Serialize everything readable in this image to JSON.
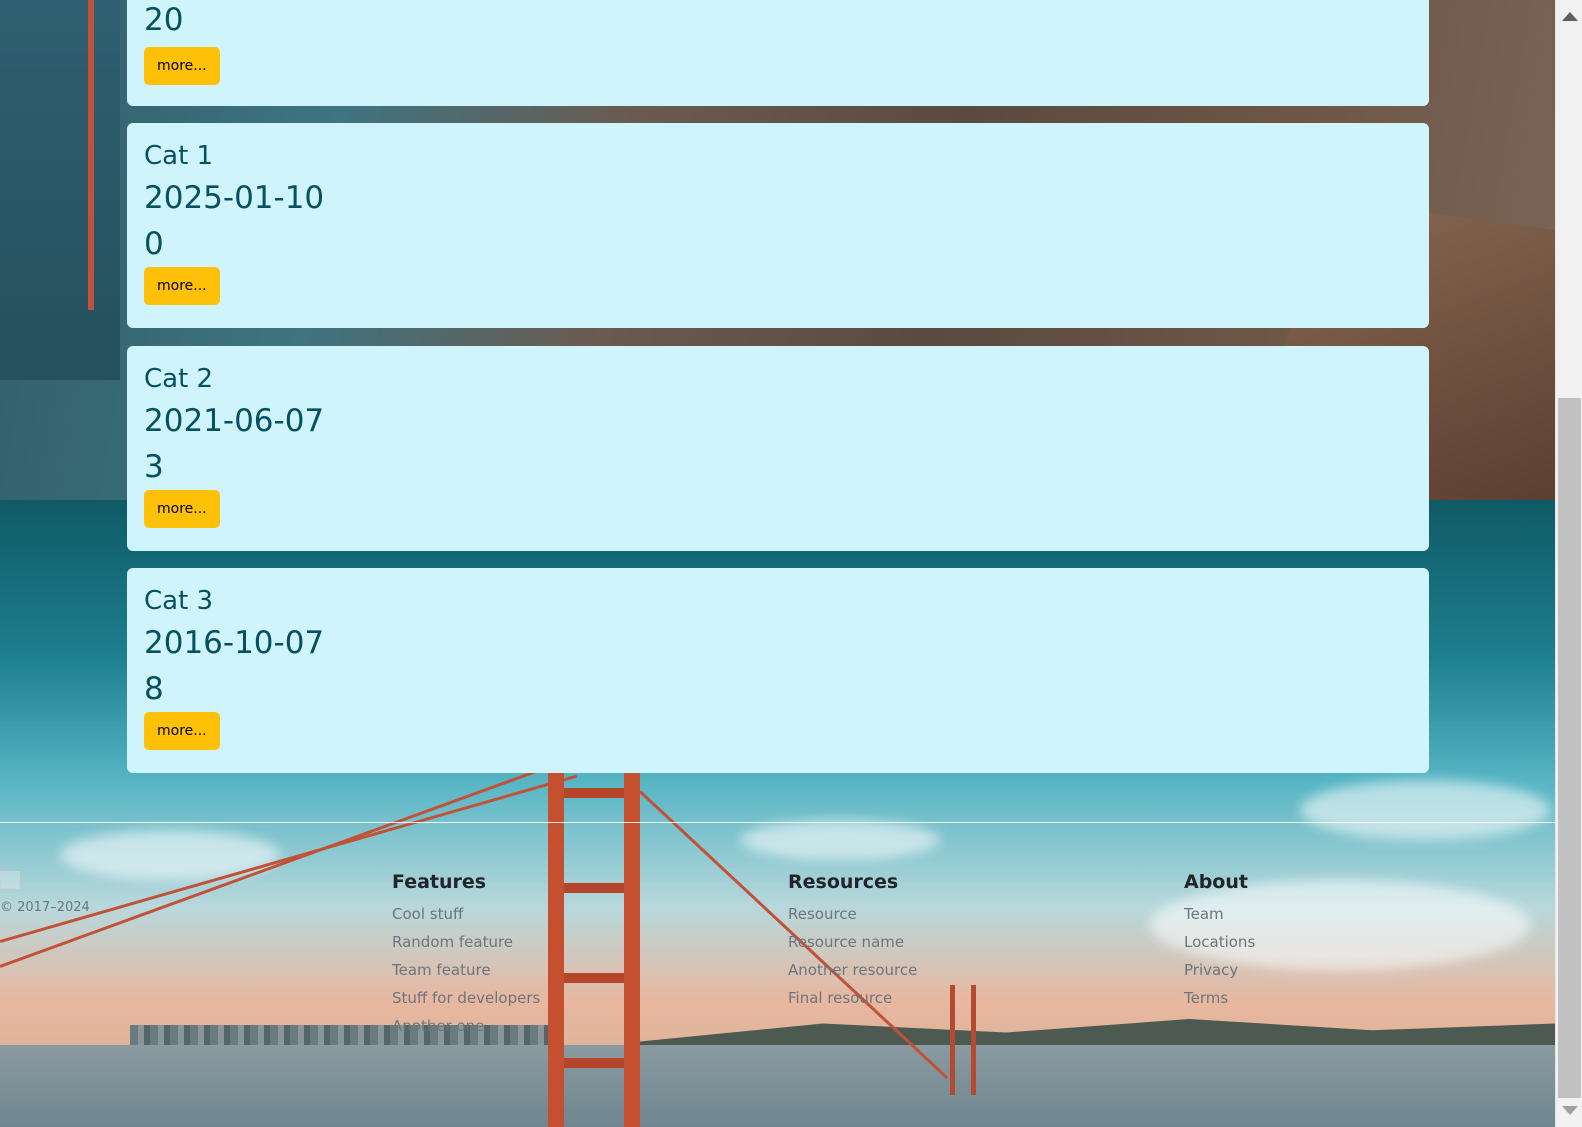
{
  "cards": [
    {
      "title": "",
      "date": "",
      "count": "20",
      "more_label": "more..."
    },
    {
      "title": "Cat 1",
      "date": "2025-01-10",
      "count": "0",
      "more_label": "more..."
    },
    {
      "title": "Cat 2",
      "date": "2021-06-07",
      "count": "3",
      "more_label": "more..."
    },
    {
      "title": "Cat 3",
      "date": "2016-10-07",
      "count": "8",
      "more_label": "more..."
    }
  ],
  "footer": {
    "copyright": "© 2017–2024",
    "columns": [
      {
        "heading": "Features",
        "links": [
          "Cool stuff",
          "Random feature",
          "Team feature",
          "Stuff for developers",
          "Another one"
        ]
      },
      {
        "heading": "Resources",
        "links": [
          "Resource",
          "Resource name",
          "Another resource",
          "Final resource"
        ]
      },
      {
        "heading": "About",
        "links": [
          "Team",
          "Locations",
          "Privacy",
          "Terms"
        ]
      }
    ]
  },
  "colors": {
    "card_bg": "#cff4fc",
    "card_text": "#055160",
    "button_bg": "#ffc107",
    "footer_link": "#6c757d"
  },
  "icons": {
    "footer_logo": "broken-image-icon",
    "scroll_up": "chevron-up-icon",
    "scroll_down": "chevron-down-icon"
  }
}
